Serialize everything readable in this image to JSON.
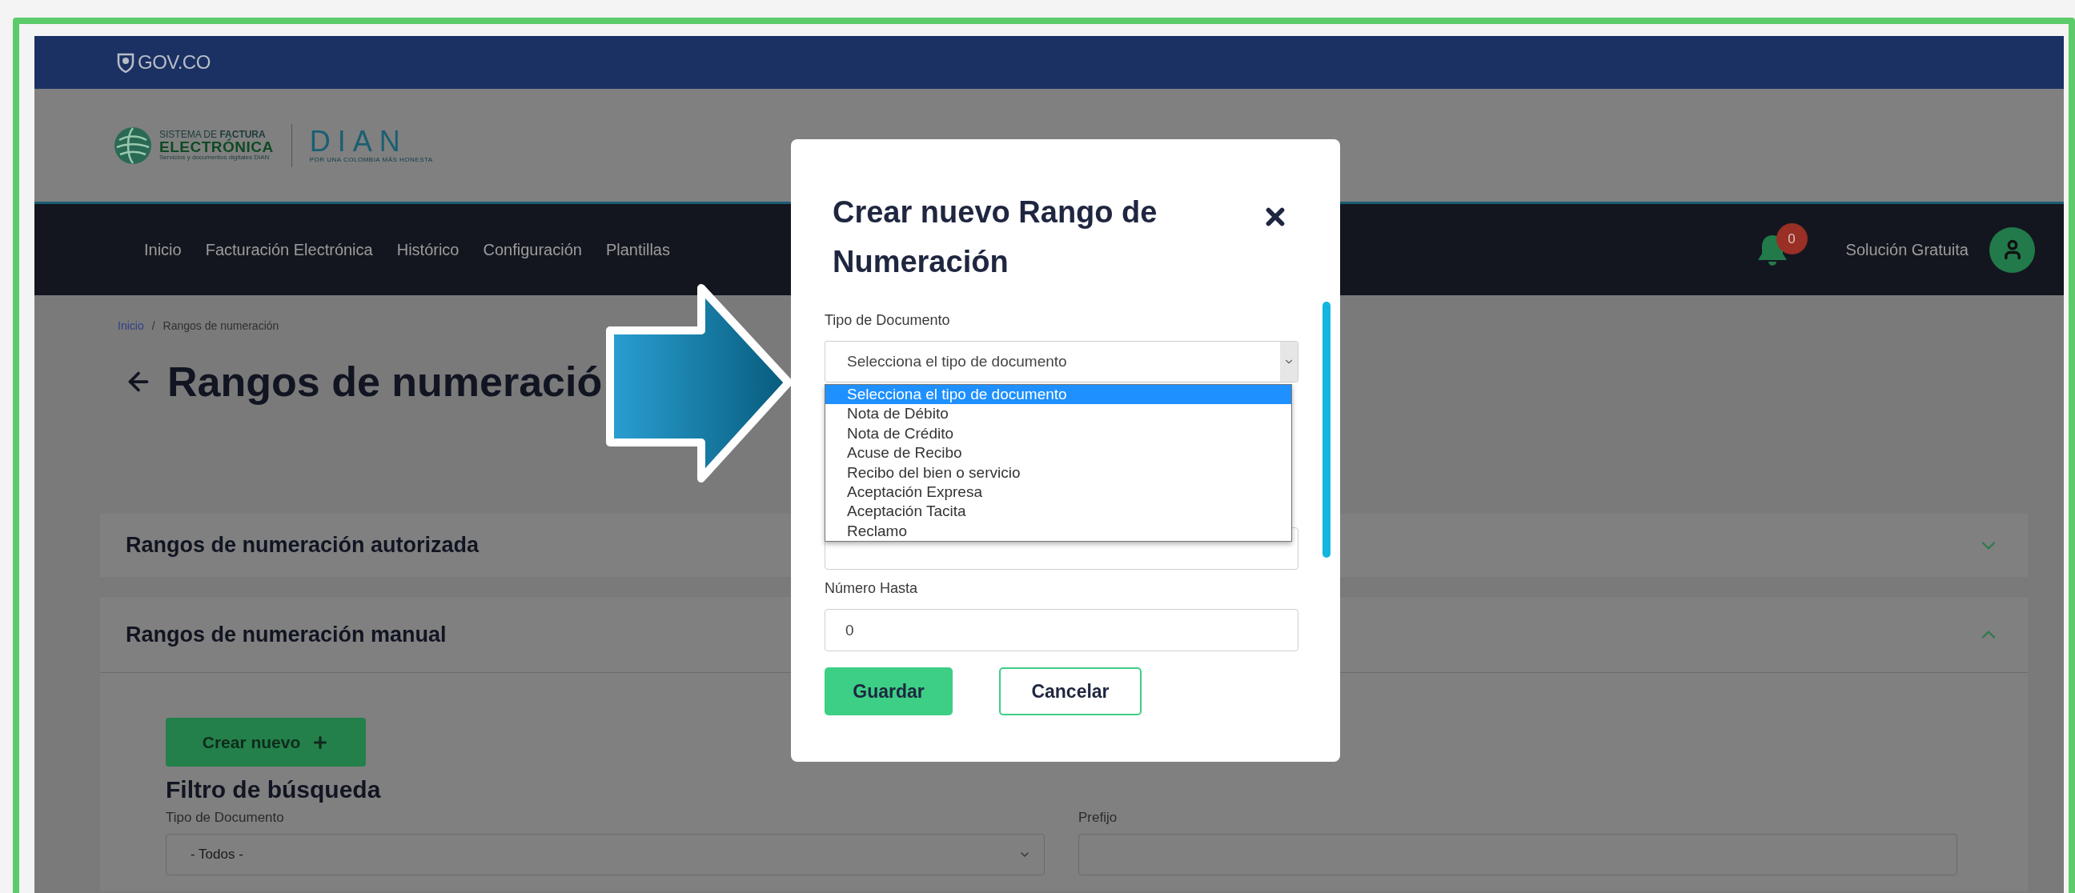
{
  "gov_bar": {
    "label": "GOV.CO"
  },
  "brand": {
    "system_prefix": "SISTEMA DE",
    "system_bold": "FACTURA",
    "system_name": "ELECTRÓNICA",
    "system_sub": "Servicios y documentos digitales DIAN",
    "agency": "DIAN",
    "agency_tagline": "POR UNA COLOMBIA MÁS HONESTA"
  },
  "nav": {
    "items": [
      "Inicio",
      "Facturación Electrónica",
      "Histórico",
      "Configuración",
      "Plantillas"
    ],
    "notifications": "0",
    "user": "Solución Gratuita"
  },
  "breadcrumb": {
    "separator": "/",
    "items": [
      {
        "label": "Inicio",
        "link": true
      },
      {
        "label": "Rangos de numeración",
        "link": false
      }
    ]
  },
  "page_title": "Rangos de numeració",
  "sections": [
    {
      "title": "Rangos de numeración autorizada",
      "expanded": false
    },
    {
      "title": "Rangos de numeración manual",
      "expanded": true
    }
  ],
  "create_button": "Crear nuevo",
  "filter": {
    "title": "Filtro de búsqueda",
    "fields": [
      {
        "label": "Tipo de Documento",
        "kind": "select",
        "value": "- Todos -"
      },
      {
        "label": "Prefijo",
        "kind": "text"
      }
    ]
  },
  "modal": {
    "title": "Crear nuevo Rango de Numeración",
    "document_type": {
      "label": "Tipo de Documento",
      "value": "Selecciona el tipo de documento",
      "options": [
        {
          "label": "Selecciona el tipo de documento",
          "selected": true
        },
        {
          "label": "Nota de Débito",
          "selected": false
        },
        {
          "label": "Nota de Crédito",
          "selected": false
        },
        {
          "label": "Acuse de Recibo",
          "selected": false
        },
        {
          "label": "Recibo del bien o servicio",
          "selected": false
        },
        {
          "label": "Aceptación Expresa",
          "selected": false
        },
        {
          "label": "Aceptación Tacita",
          "selected": false
        },
        {
          "label": "Reclamo",
          "selected": false
        }
      ]
    },
    "number_to": {
      "label": "Número Hasta",
      "value": "0"
    },
    "buttons": [
      {
        "label": "Guardar",
        "kind": "primary"
      },
      {
        "label": "Cancelar",
        "kind": "secondary"
      }
    ]
  }
}
